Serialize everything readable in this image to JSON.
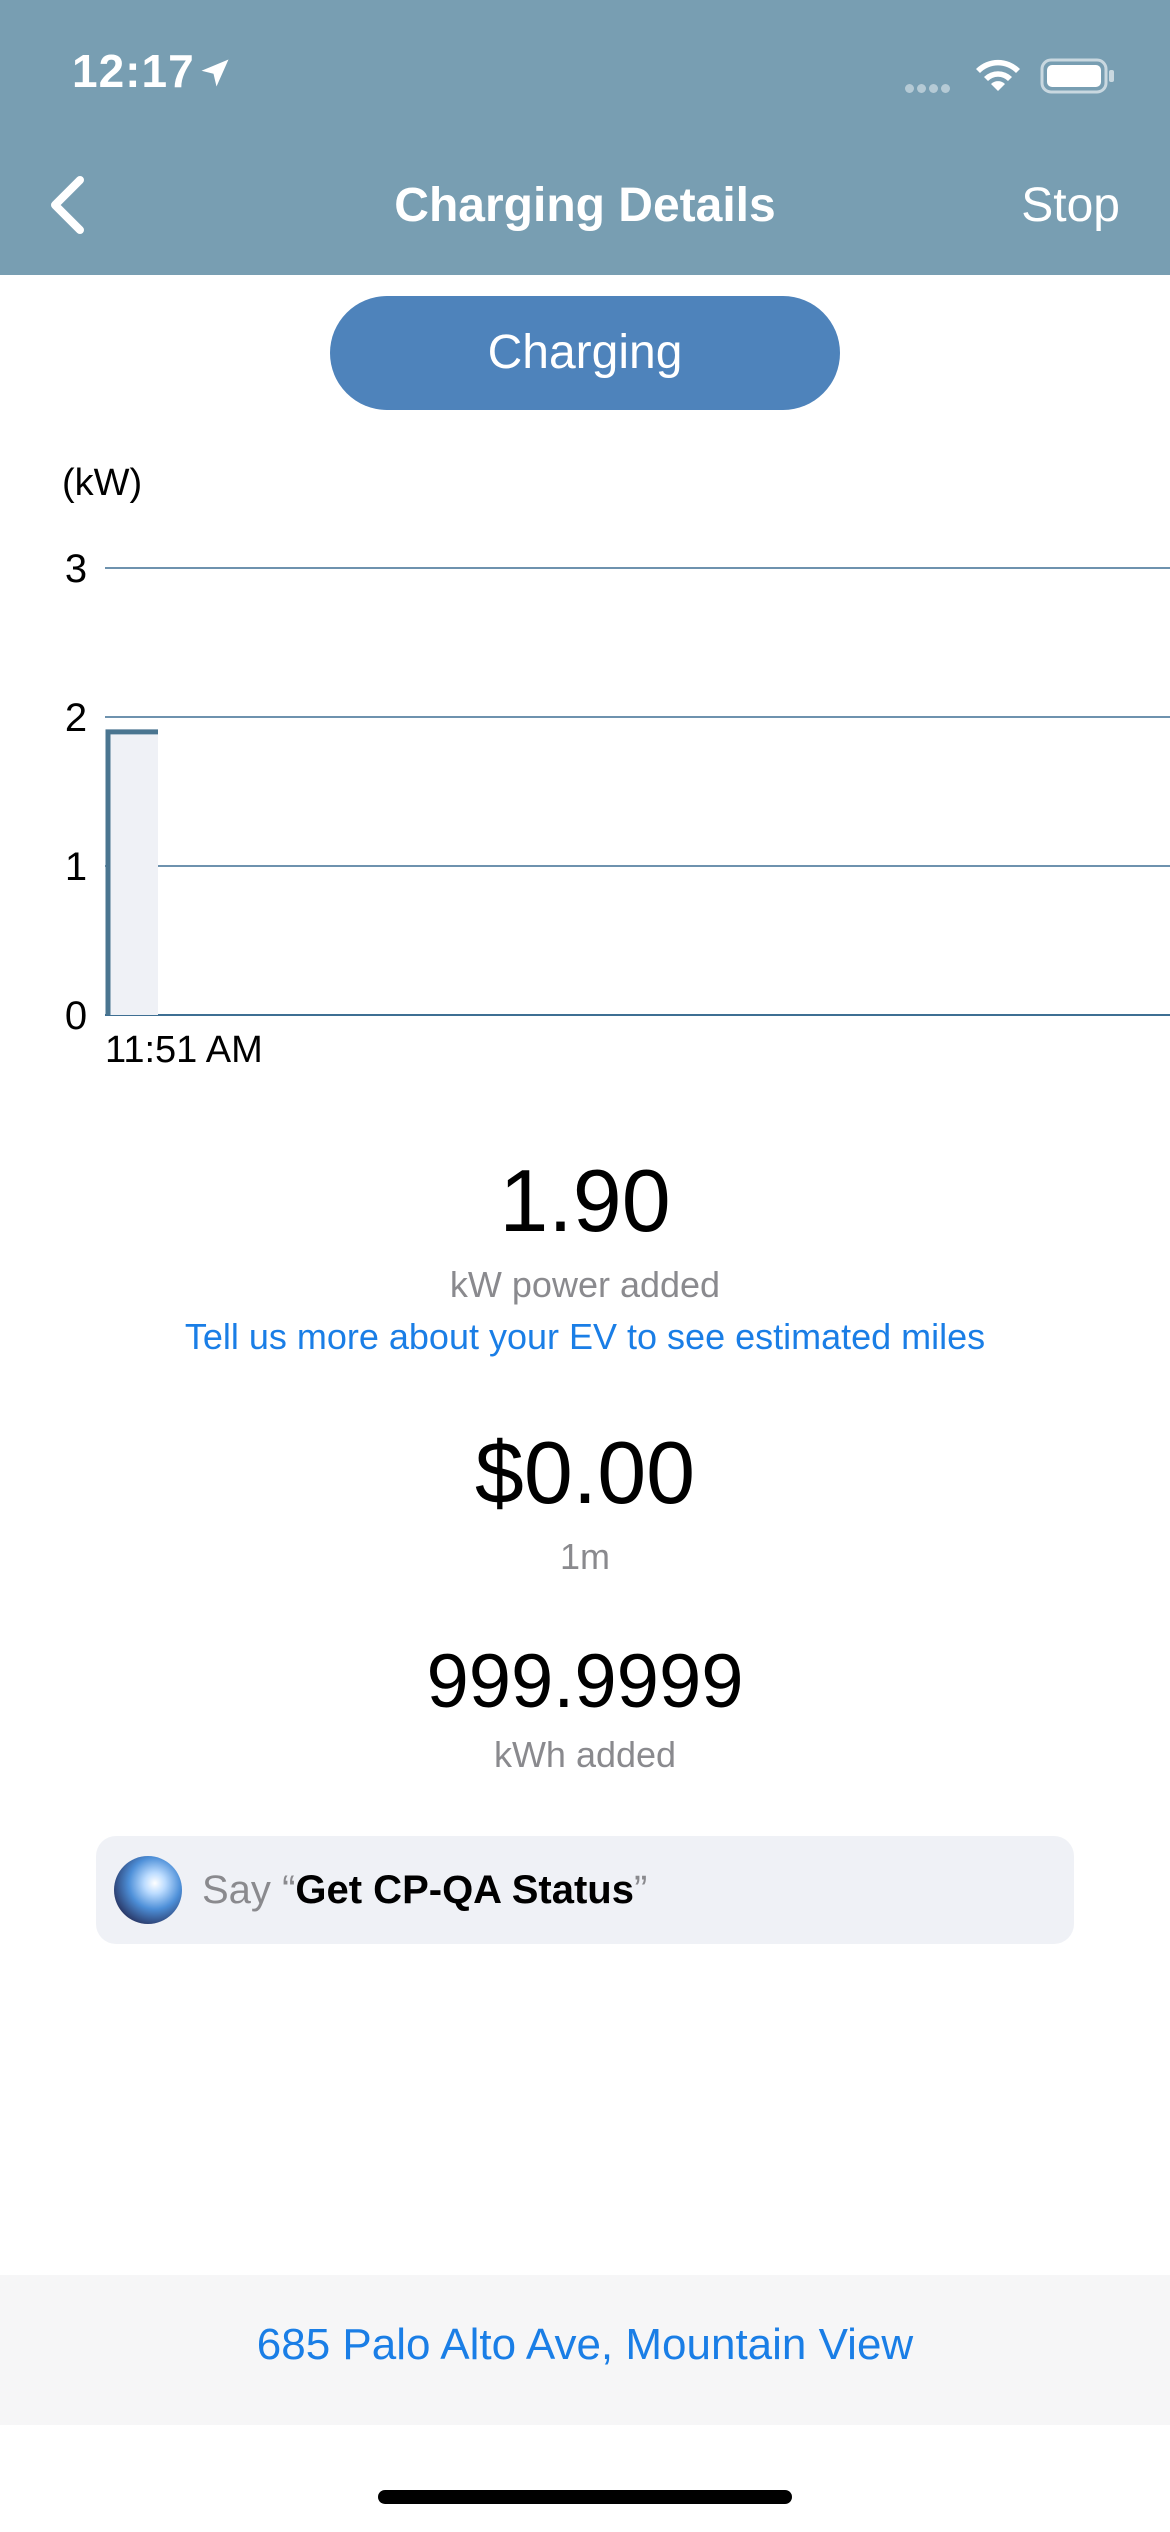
{
  "status_bar": {
    "time": "12:17"
  },
  "nav": {
    "title": "Charging Details",
    "stop_label": "Stop"
  },
  "status_pill": "Charging",
  "chart_data": {
    "type": "line",
    "ylabel": "(kW)",
    "yticks": [
      "0",
      "1",
      "2",
      "3"
    ],
    "ylim": [
      0,
      3
    ],
    "xticks": [
      "11:51 AM"
    ],
    "x": [
      "11:51 AM"
    ],
    "series": [
      {
        "values": [
          1.9
        ]
      }
    ],
    "grid": true
  },
  "stats": {
    "power_value": "1.90",
    "power_label": "kW power added",
    "ev_link": "Tell us more about your EV to see estimated miles",
    "cost_value": "$0.00",
    "cost_label": "1m",
    "energy_value": "999.9999",
    "energy_label": "kWh added"
  },
  "siri": {
    "say": "Say",
    "open_quote": "“",
    "phrase": "Get CP-QA Status",
    "close_quote": "”"
  },
  "address": "685 Palo Alto Ave, Mountain View",
  "colors": {
    "header": "#789eb2",
    "pill": "#4e83bb",
    "link": "#1a7ee6",
    "chart_line": "#4a7590"
  }
}
